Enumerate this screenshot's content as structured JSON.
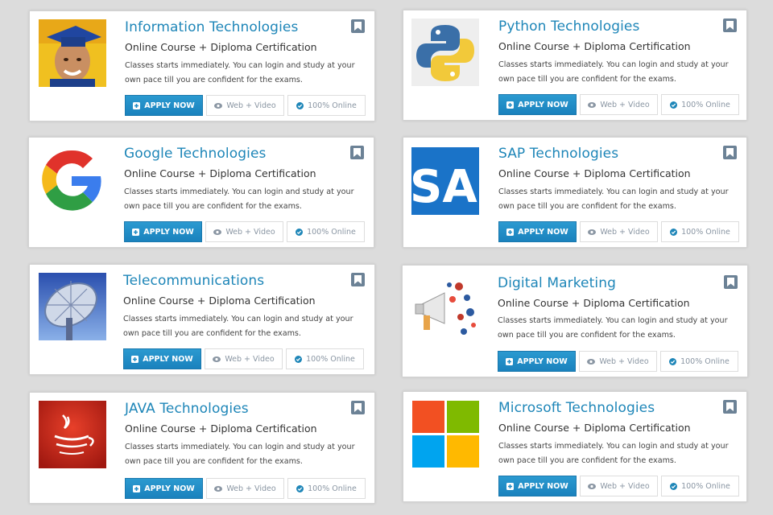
{
  "cards": [
    {
      "title": "Information Technologies",
      "subtitle": "Online Course + Diploma Certification",
      "desc": "Classes starts immediately. You can login and study at your own pace till you are confident for the exams.",
      "apply": "APPLY NOW",
      "web": "Web + Video",
      "online": "100% Online",
      "image": "graduate-photo"
    },
    {
      "title": "Python Technologies",
      "subtitle": "Online Course + Diploma Certification",
      "desc": "Classes starts immediately. You can login and study at your own pace till you are confident for the exams.",
      "apply": "APPLY NOW",
      "web": "Web + Video",
      "online": "100% Online",
      "image": "python-logo"
    },
    {
      "title": "Google Technologies",
      "subtitle": "Online Course + Diploma Certification",
      "desc": "Classes starts immediately. You can login and study at your own pace till you are confident for the exams.",
      "apply": "APPLY NOW",
      "web": "Web + Video",
      "online": "100% Online",
      "image": "google-logo"
    },
    {
      "title": "SAP Technologies",
      "subtitle": "Online Course + Diploma Certification",
      "desc": "Classes starts immediately. You can login and study at your own pace till you are confident for the exams.",
      "apply": "APPLY NOW",
      "web": "Web + Video",
      "online": "100% Online",
      "image": "sap-logo",
      "image_text": "SA"
    },
    {
      "title": "Telecommunications",
      "subtitle": "Online Course + Diploma Certification",
      "desc": "Classes starts immediately. You can login and study at your own pace till you are confident for the exams.",
      "apply": "APPLY NOW",
      "web": "Web + Video",
      "online": "100% Online",
      "image": "satellite-dish-photo"
    },
    {
      "title": "Digital Marketing",
      "subtitle": "Online Course + Diploma Certification",
      "desc": "Classes starts immediately. You can login and study at your own pace till you are confident for the exams.",
      "apply": "APPLY NOW",
      "web": "Web + Video",
      "online": "100% Online",
      "image": "megaphone-illustration"
    },
    {
      "title": "JAVA Technologies",
      "subtitle": "Online Course + Diploma Certification",
      "desc": "Classes starts immediately. You can login and study at your own pace till you are confident for the exams.",
      "apply": "APPLY NOW",
      "web": "Web + Video",
      "online": "100% Online",
      "image": "java-logo"
    },
    {
      "title": "Microsoft Technologies",
      "subtitle": "Online Course + Diploma Certification",
      "desc": "Classes starts immediately. You can login and study at your own pace till you are confident for the exams.",
      "apply": "APPLY NOW",
      "web": "Web + Video",
      "online": "100% Online",
      "image": "microsoft-logo"
    }
  ],
  "colors": {
    "title": "#1e86b8",
    "apply_button": "#1e8ac4",
    "bookmark": "#6c8296",
    "background": "#dcdcdc"
  },
  "icons": {
    "apply": "plus-square-icon",
    "web": "eye-icon",
    "online": "check-circle-icon",
    "bookmark": "bookmark-icon"
  }
}
